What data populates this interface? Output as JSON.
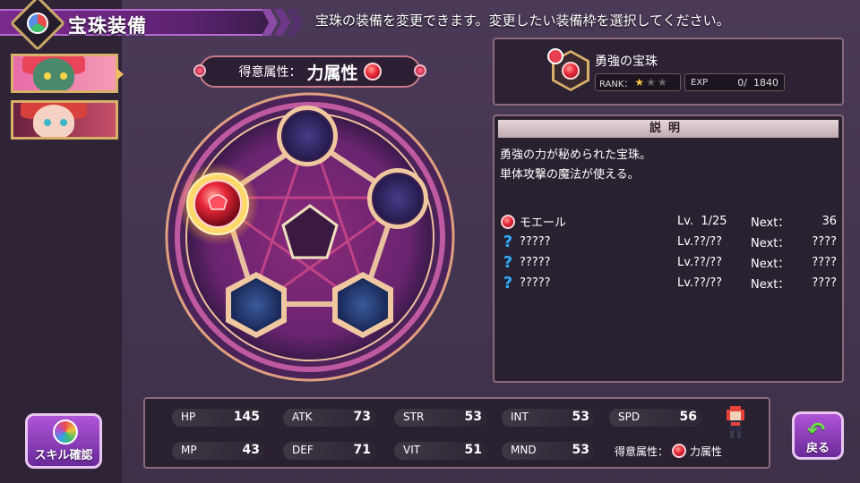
{
  "header": {
    "title": "宝珠装備",
    "instruction": "宝珠の装備を変更できます。変更したい装備枠を選択してください。"
  },
  "characters": [
    {
      "name": "character-1",
      "selected": true
    },
    {
      "name": "character-2",
      "selected": false
    }
  ],
  "affinity": {
    "label": "得意属性：",
    "value": "力属性",
    "icon": "red-power-orb-icon"
  },
  "board": {
    "slots": [
      {
        "shape": "circle",
        "state": "empty"
      },
      {
        "shape": "circle",
        "state": "empty"
      },
      {
        "shape": "circle",
        "state": "equipped-red-orb-selected"
      },
      {
        "shape": "hexagon",
        "state": "empty"
      },
      {
        "shape": "hexagon",
        "state": "empty"
      }
    ]
  },
  "jewel": {
    "name": "勇強の宝珠",
    "rank_label": "RANK：",
    "rank_stars": 3,
    "rank_filled": 1,
    "exp_label": "EXP",
    "exp_value": "0/  1840"
  },
  "description": {
    "header": "説明",
    "lines": [
      "勇強の力が秘められた宝珠。",
      "単体攻撃の魔法が使える。"
    ]
  },
  "skills": [
    {
      "icon": "red-orb-icon",
      "name": "モエール",
      "lv": "Lv.  1/25",
      "next_label": "Next：",
      "next": "36"
    },
    {
      "icon": "question-icon",
      "name": "?????",
      "lv": "Lv.??/??",
      "next_label": "Next：",
      "next": "????"
    },
    {
      "icon": "question-icon",
      "name": "?????",
      "lv": "Lv.??/??",
      "next_label": "Next：",
      "next": "????"
    },
    {
      "icon": "question-icon",
      "name": "?????",
      "lv": "Lv.??/??",
      "next_label": "Next：",
      "next": "????"
    }
  ],
  "stats": {
    "hp": {
      "label": "HP",
      "value": "145"
    },
    "atk": {
      "label": "ATK",
      "value": "73"
    },
    "str": {
      "label": "STR",
      "value": "53"
    },
    "int": {
      "label": "INT",
      "value": "53"
    },
    "spd": {
      "label": "SPD",
      "value": "56"
    },
    "mp": {
      "label": "MP",
      "value": "43"
    },
    "def": {
      "label": "DEF",
      "value": "71"
    },
    "vit": {
      "label": "VIT",
      "value": "51"
    },
    "mnd": {
      "label": "MND",
      "value": "53"
    },
    "affinity_label": "得意属性：",
    "affinity_value": "力属性"
  },
  "buttons": {
    "skill_check": "スキル確認",
    "back": "戻る"
  },
  "colors": {
    "accent": "#7b2b8e",
    "gold_border": "#d8b06a",
    "power_red": "#e8283a",
    "unknown_blue": "#3aa8f0"
  }
}
